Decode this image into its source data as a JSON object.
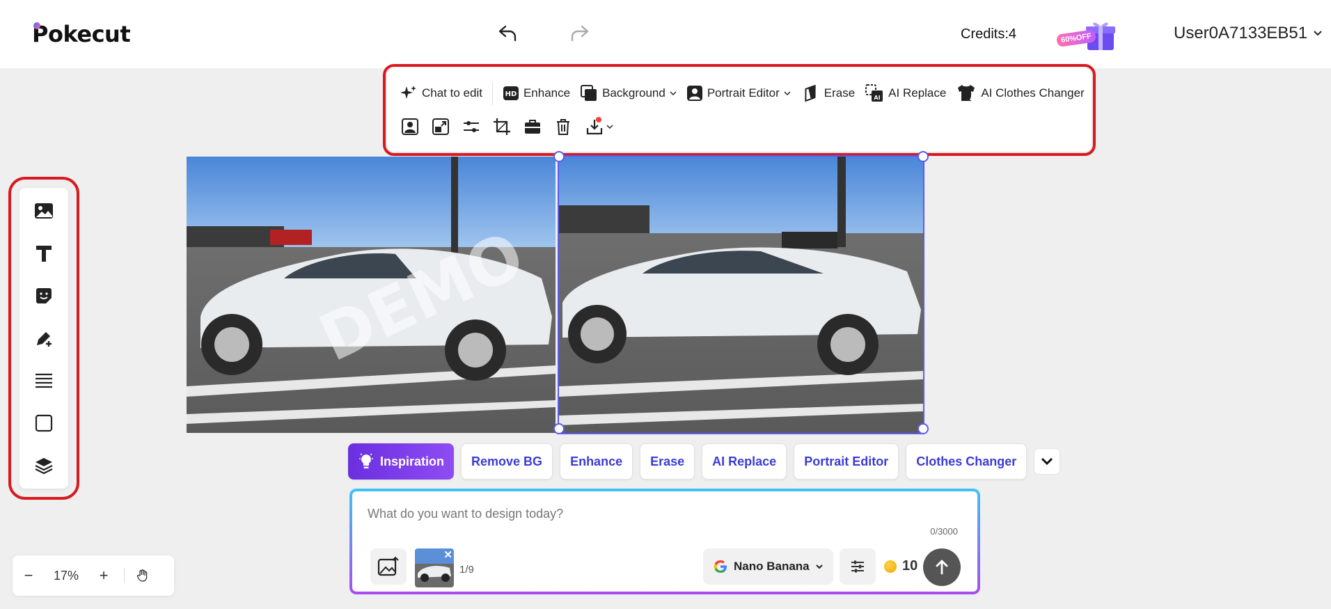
{
  "header": {
    "logo": "Pokecut",
    "credits": "Credits:4",
    "promo": "60%OFF",
    "user": "User0A7133EB51"
  },
  "toolbar": {
    "row1": [
      {
        "label": "Chat to edit",
        "icon": "sparkle-icon"
      },
      {
        "label": "Enhance",
        "icon": "hd-icon"
      },
      {
        "label": "Background",
        "icon": "background-icon",
        "dropdown": true
      },
      {
        "label": "Portrait Editor",
        "icon": "portrait-icon",
        "dropdown": true
      },
      {
        "label": "Erase",
        "icon": "eraser-icon"
      },
      {
        "label": "AI Replace",
        "icon": "ai-replace-icon"
      },
      {
        "label": "AI Clothes Changer",
        "icon": "shirt-icon"
      }
    ],
    "row2_icons": [
      "remove-bg-icon",
      "resize-icon",
      "adjust-icon",
      "crop-icon",
      "toolbox-icon",
      "delete-icon",
      "download-icon"
    ]
  },
  "rail_icons": [
    "image-icon",
    "text-icon",
    "sticker-icon",
    "draw-icon",
    "lines-icon",
    "shape-icon",
    "layers-icon"
  ],
  "canvas": {
    "watermark": "DEMO"
  },
  "chips": [
    "Remove BG",
    "Enhance",
    "Erase",
    "AI Replace",
    "Portrait Editor",
    "Clothes Changer"
  ],
  "chip_primary": "Inspiration",
  "prompt": {
    "placeholder": "What do you want to design today?",
    "counter": "0/3000",
    "image_count": "1/9",
    "model": "Nano Banana",
    "cost": "10"
  },
  "zoom": {
    "minus": "−",
    "value": "17%",
    "plus": "+"
  }
}
